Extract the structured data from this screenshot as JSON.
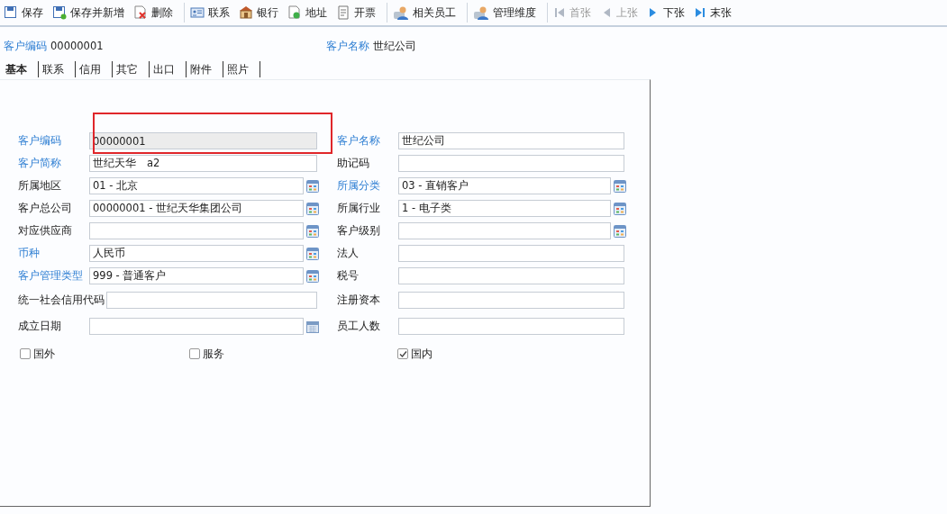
{
  "toolbar": {
    "groups": [
      [
        {
          "label": "保存",
          "kind": "save",
          "disabled": false
        },
        {
          "label": "保存并新增",
          "kind": "save-new",
          "disabled": false
        },
        {
          "label": "删除",
          "kind": "delete",
          "disabled": false
        }
      ],
      [
        {
          "label": "联系",
          "kind": "card",
          "disabled": false
        },
        {
          "label": "银行",
          "kind": "bank",
          "disabled": false
        },
        {
          "label": "地址",
          "kind": "address",
          "disabled": false
        },
        {
          "label": "开票",
          "kind": "invoice",
          "disabled": false
        }
      ],
      [
        {
          "label": "相关员工",
          "kind": "person",
          "disabled": false
        }
      ],
      [
        {
          "label": "管理维度",
          "kind": "person",
          "disabled": false
        }
      ],
      [
        {
          "label": "首张",
          "kind": "first",
          "disabled": true
        },
        {
          "label": "上张",
          "kind": "prev",
          "disabled": true
        },
        {
          "label": "下张",
          "kind": "next",
          "disabled": false
        },
        {
          "label": "末张",
          "kind": "last",
          "disabled": false
        }
      ]
    ]
  },
  "header": {
    "code_label": "客户编码",
    "code": "00000001",
    "name_label": "客户名称",
    "name": "世纪公司"
  },
  "tabs": [
    {
      "label": "基本",
      "selected": true
    },
    {
      "label": "联系",
      "selected": false
    },
    {
      "label": "信用",
      "selected": false
    },
    {
      "label": "其它",
      "selected": false
    },
    {
      "label": "出口",
      "selected": false
    },
    {
      "label": "附件",
      "selected": false
    },
    {
      "label": "照片",
      "selected": false
    }
  ],
  "form": {
    "rows": [
      [
        {
          "label": "客户编码",
          "value": "00000001",
          "kind": "text",
          "required": true,
          "disabled": true,
          "highlighted": true
        },
        {
          "label": "客户名称",
          "value": "世纪公司",
          "kind": "text",
          "required": true,
          "disabled": false,
          "highlighted": false
        }
      ],
      [
        {
          "label": "客户简称",
          "value": "世纪天华　a2",
          "kind": "text",
          "required": true,
          "disabled": false,
          "highlighted": false
        },
        {
          "label": "助记码",
          "kind": "text",
          "required": false,
          "disabled": false,
          "highlighted": false
        }
      ],
      [
        {
          "label": "所属地区",
          "value": "01 - 北京",
          "kind": "lookup",
          "required": false,
          "disabled": false,
          "highlighted": false
        },
        {
          "label": "所属分类",
          "value": "03 - 直销客户",
          "kind": "lookup",
          "required": true,
          "disabled": false,
          "highlighted": false
        }
      ],
      [
        {
          "label": "客户总公司",
          "value": "00000001 - 世纪天华集团公司",
          "kind": "lookup",
          "required": false,
          "disabled": false,
          "highlighted": false
        },
        {
          "label": "所属行业",
          "value": "1 - 电子类",
          "kind": "lookup",
          "required": false,
          "disabled": false,
          "highlighted": false
        }
      ],
      [
        {
          "label": "对应供应商",
          "kind": "lookup",
          "required": false,
          "disabled": false,
          "highlighted": false
        },
        {
          "label": "客户级别",
          "kind": "lookup",
          "required": false,
          "disabled": false,
          "highlighted": false
        }
      ],
      [
        {
          "label": "币种",
          "value": "人民币",
          "kind": "lookup",
          "required": true,
          "disabled": false,
          "highlighted": false
        },
        {
          "label": "法人",
          "kind": "text",
          "required": false,
          "disabled": false,
          "highlighted": false
        }
      ],
      [
        {
          "label": "客户管理类型",
          "value": "999 - 普通客户",
          "kind": "lookup",
          "required": true,
          "disabled": false,
          "highlighted": false
        },
        {
          "label": "税号",
          "kind": "text",
          "required": false,
          "disabled": false,
          "highlighted": false
        }
      ],
      [
        {
          "label": "统一社会信用代码",
          "kind": "text",
          "required": false,
          "disabled": false,
          "highlighted": false
        },
        {
          "label": "注册资本",
          "kind": "text",
          "required": false,
          "disabled": false,
          "highlighted": false
        }
      ],
      [
        {
          "label": "成立日期",
          "kind": "date",
          "required": false,
          "disabled": false,
          "highlighted": false
        },
        {
          "label": "员工人数",
          "kind": "text",
          "required": false,
          "disabled": false,
          "highlighted": false
        }
      ]
    ],
    "checkboxes": [
      {
        "label": "国外",
        "checked": false
      },
      {
        "label": "服务",
        "checked": false
      },
      {
        "label": "国内",
        "checked": true
      }
    ]
  }
}
